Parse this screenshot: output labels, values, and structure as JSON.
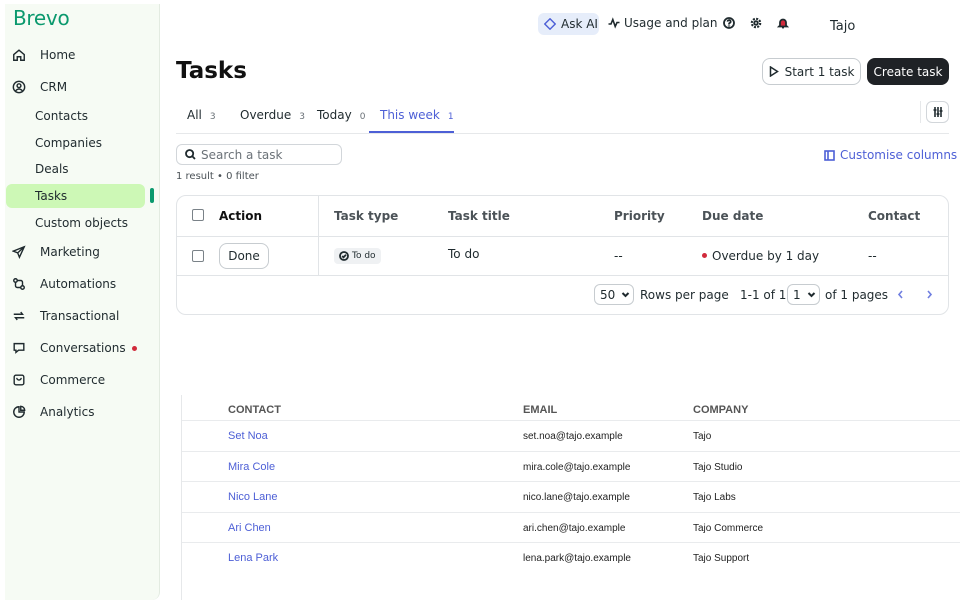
{
  "brand": "Brevo",
  "sidebar": {
    "items": [
      {
        "label": "Home",
        "icon": "home-icon"
      },
      {
        "label": "CRM",
        "icon": "user-circle-icon"
      },
      {
        "label": "Marketing",
        "icon": "send-icon"
      },
      {
        "label": "Automations",
        "icon": "automation-icon"
      },
      {
        "label": "Transactional",
        "icon": "repeat-icon"
      },
      {
        "label": "Conversations",
        "icon": "chat-icon"
      },
      {
        "label": "Commerce",
        "icon": "bag-icon"
      },
      {
        "label": "Analytics",
        "icon": "pie-chart-icon"
      }
    ],
    "crm_sub": [
      "Contacts",
      "Companies",
      "Deals",
      "Tasks",
      "Custom objects"
    ]
  },
  "topbar": {
    "ask_ai": "Ask AI",
    "usage": "Usage and plan",
    "user": "Tajo"
  },
  "header": {
    "title": "Tasks",
    "start_task": "Start 1 task",
    "create_task": "Create task"
  },
  "tabs": [
    {
      "label": "All",
      "count": "3"
    },
    {
      "label": "Overdue",
      "count": "3"
    },
    {
      "label": "Today",
      "count": "0"
    },
    {
      "label": "This week",
      "count": "1"
    }
  ],
  "search": {
    "placeholder": "Search a task"
  },
  "customise": "Customise columns",
  "result_info": "1 result  •  0 filter",
  "table": {
    "headers": {
      "action": "Action",
      "type": "Task type",
      "title": "Task title",
      "priority": "Priority",
      "due": "Due date",
      "contact": "Contact"
    },
    "row": {
      "action": "Done",
      "type": "To do",
      "title": "To do",
      "priority": "--",
      "due": "Overdue by 1 day",
      "contact": "--"
    }
  },
  "pagination": {
    "rows_value": "50",
    "rows_label": "Rows per page",
    "range": "1-1 of 1",
    "page_value": "1",
    "pages_label": "of 1 pages"
  },
  "contacts": {
    "headers": {
      "contact": "CONTACT",
      "email": "EMAIL",
      "company": "COMPANY"
    },
    "rows": [
      {
        "name": "Set Noa",
        "email": "set.noa@tajo.example",
        "company": "Tajo"
      },
      {
        "name": "Mira Cole",
        "email": "mira.cole@tajo.example",
        "company": "Tajo Studio"
      },
      {
        "name": "Nico Lane",
        "email": "nico.lane@tajo.example",
        "company": "Tajo Labs"
      },
      {
        "name": "Ari Chen",
        "email": "ari.chen@tajo.example",
        "company": "Tajo Commerce"
      },
      {
        "name": "Lena Park",
        "email": "lena.park@tajo.example",
        "company": "Tajo Support"
      }
    ]
  },
  "colors": {
    "brand": "#0b996e",
    "active_bg": "#cdf8b6",
    "accent": "#4d5fd6",
    "danger": "#d12a3b"
  }
}
